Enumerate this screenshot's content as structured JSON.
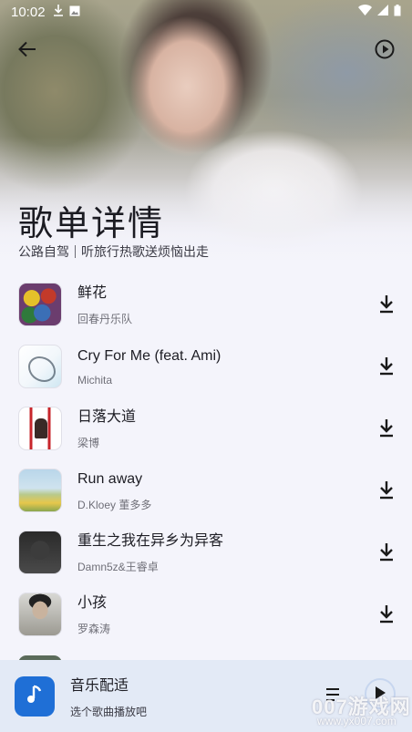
{
  "status_bar": {
    "time": "10:02",
    "left_icons": [
      "download-icon",
      "image-icon"
    ],
    "right_icons": [
      "wifi-icon",
      "signal-icon",
      "battery-icon"
    ]
  },
  "header": {
    "back_icon": "arrow-left-icon",
    "play_all_icon": "play-circle-icon",
    "title": "歌单详情",
    "playlist_name": "公路自驾",
    "playlist_desc": "听旅行热歌送烦恼出走"
  },
  "songs": [
    {
      "title": "鲜花",
      "artist": "回春丹乐队"
    },
    {
      "title": "Cry For Me (feat. Ami)",
      "artist": "Michita"
    },
    {
      "title": "日落大道",
      "artist": "梁博"
    },
    {
      "title": "Run away",
      "artist": "D.Kloey 董多多"
    },
    {
      "title": "重生之我在异乡为异客",
      "artist": "Damn5z&王睿卓"
    },
    {
      "title": "小孩",
      "artist": "罗森涛"
    }
  ],
  "player": {
    "icon": "music-note-icon",
    "title": "音乐配适",
    "subtitle": "选个歌曲播放吧",
    "list_icon": "playlist-icon",
    "play_icon": "play-icon"
  },
  "watermark": {
    "text": "007游戏网",
    "url": "www.yx007.com"
  },
  "colors": {
    "accent": "#1f6fd6",
    "background": "#f4f4fb",
    "player_bar": "#e3eaf6"
  }
}
